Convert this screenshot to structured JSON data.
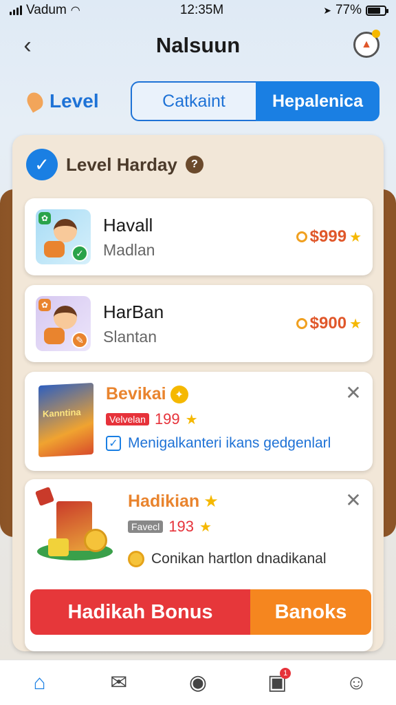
{
  "status_bar": {
    "carrier": "Vadum",
    "time": "12:35M",
    "battery": "77%",
    "battery_fraction": 0.77
  },
  "header": {
    "title": "Nalsuun"
  },
  "tabs": {
    "level": "Level",
    "catkaint": "Catkaint",
    "hepalenica": "Hepalenica"
  },
  "panel": {
    "title": "Level Harday"
  },
  "items": [
    {
      "title": "Havall",
      "subtitle": "Madlan",
      "price": "$999"
    },
    {
      "title": "HarBan",
      "subtitle": "Slantan",
      "price": "$900"
    }
  ],
  "promos": [
    {
      "title": "Bevikai",
      "box_text": "Kanntina",
      "tag": "Velvelan",
      "number": "199",
      "check_text": "Menigalkanteri ikans gedgenlarl"
    },
    {
      "title": "Hadikian",
      "tag": "Favecl",
      "number": "193",
      "info_text": "Conikan hartlon dnadikanal"
    }
  ],
  "buttons": {
    "primary": "Hadikah Bonus",
    "secondary": "Banoks"
  },
  "tabbar": {
    "notification_count": "1"
  },
  "colors": {
    "accent": "#1a7fe3",
    "danger": "#e6373a",
    "warning": "#f5861f",
    "price": "#e0572a"
  }
}
